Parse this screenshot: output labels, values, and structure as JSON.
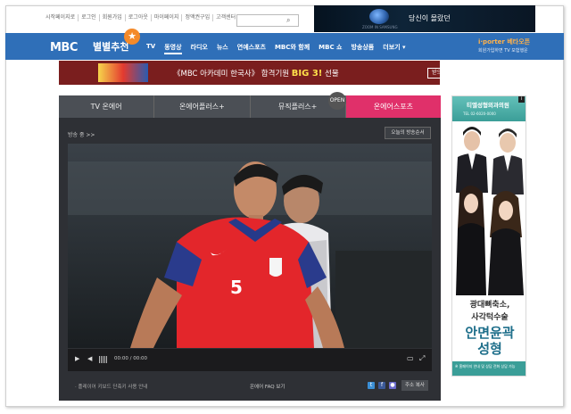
{
  "util_links": [
    "시작페이지로",
    "로그인",
    "회원가입",
    "로그아웃",
    "마이페이지",
    "정액권구입",
    "고객센터"
  ],
  "search": {
    "placeholder": ""
  },
  "top_ad": {
    "brand": "ZOOM IN SAMSUNG",
    "text": "당신이 몰랐던"
  },
  "nav": {
    "logo": "MBC",
    "pick": "별별추천",
    "items": [
      "TV",
      "동영상",
      "라디오",
      "뉴스",
      "연예스포츠",
      "MBC와 함께",
      "MBC 쇼",
      "방송상품",
      "더보기 ▾"
    ],
    "active_index": 1,
    "iporter": "i·porter 베타오픈",
    "iporter_sub": "회원가입하면 TV 모험행운"
  },
  "banner": {
    "text_pre": "《MBC 아카데미 한국사》 합격기원 ",
    "text_big": "BIG 3!",
    "text_post": " 선물",
    "button": "받으러 가기 ›"
  },
  "tabs": [
    {
      "label": "TV 온에어",
      "active": false
    },
    {
      "label": "온에어플러스+",
      "active": false
    },
    {
      "label": "뮤직플러스+",
      "active": false
    },
    {
      "label": "온에어스포츠",
      "active": true
    }
  ],
  "open_badge": "OPEN",
  "player": {
    "onair_label": "방송 중 >>",
    "schedule_button": "오늘의 방송순서",
    "time": "00:00 / 00:00",
    "footer_note": "· 플레이어 키보드 단축키 사용 안내",
    "faq": "온에어 FAQ 보기",
    "address_button": "주소 복사",
    "jersey_number": "5"
  },
  "side_ad": {
    "clinic": "티엘성형외과의원",
    "tel": "TEL 02-6020-0000",
    "line1": "광대뼈축소,",
    "line2": "사각턱수술",
    "line3": "안면윤곽",
    "line4": "성형",
    "foot": "※ 홈페이지 안내 및 상담 전화 상담 가능"
  },
  "colors": {
    "nav_blue": "#2f6fb8",
    "tab_active": "#e0306a",
    "accent_orange": "#f48a2a"
  }
}
